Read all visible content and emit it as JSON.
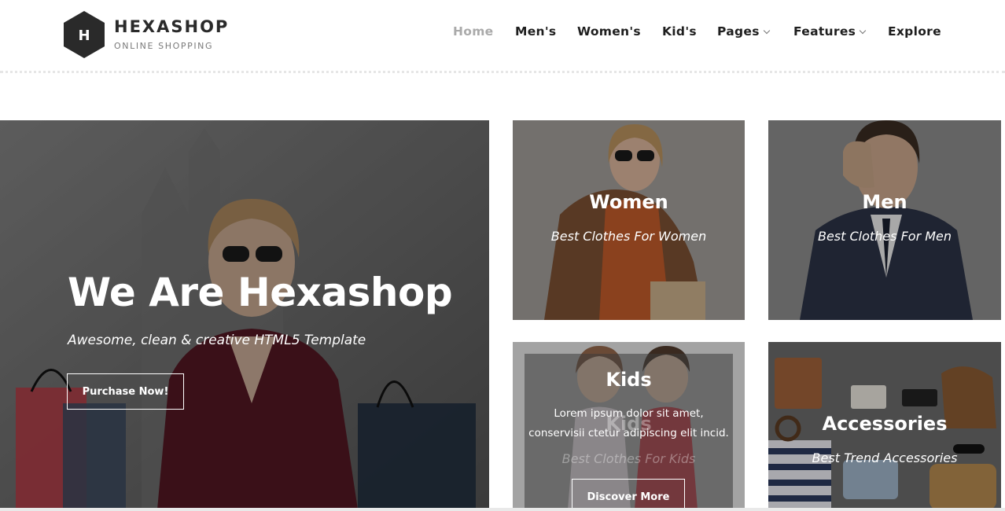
{
  "brand": {
    "logo_letter": "H",
    "name": "HEXASHOP",
    "tagline": "ONLINE SHOPPING"
  },
  "nav": {
    "items": [
      {
        "label": "Home",
        "active": true
      },
      {
        "label": "Men's"
      },
      {
        "label": "Women's"
      },
      {
        "label": "Kid's"
      },
      {
        "label": "Pages",
        "dropdown": true
      },
      {
        "label": "Features",
        "dropdown": true
      },
      {
        "label": "Explore"
      }
    ]
  },
  "hero": {
    "title": "We Are Hexashop",
    "subtitle": "Awesome, clean & creative HTML5 Template",
    "button": "Purchase Now!"
  },
  "categories": {
    "women": {
      "title": "Women",
      "subtitle": "Best Clothes For Women"
    },
    "men": {
      "title": "Men",
      "subtitle": "Best Clothes For Men"
    },
    "kids": {
      "title": "Kids",
      "subtitle": "Best Clothes For Kids",
      "hover_title": "Kids",
      "hover_text": "Lorem ipsum dolor sit amet, conservisii ctetur adipiscing elit incid.",
      "button": "Discover More"
    },
    "accessories": {
      "title": "Accessories",
      "subtitle": "Best Trend Accessories"
    }
  },
  "colors": {
    "accent_text": "#2a2a2a",
    "nav_active": "#aaaaaa",
    "overlay_white": "#ffffff"
  }
}
